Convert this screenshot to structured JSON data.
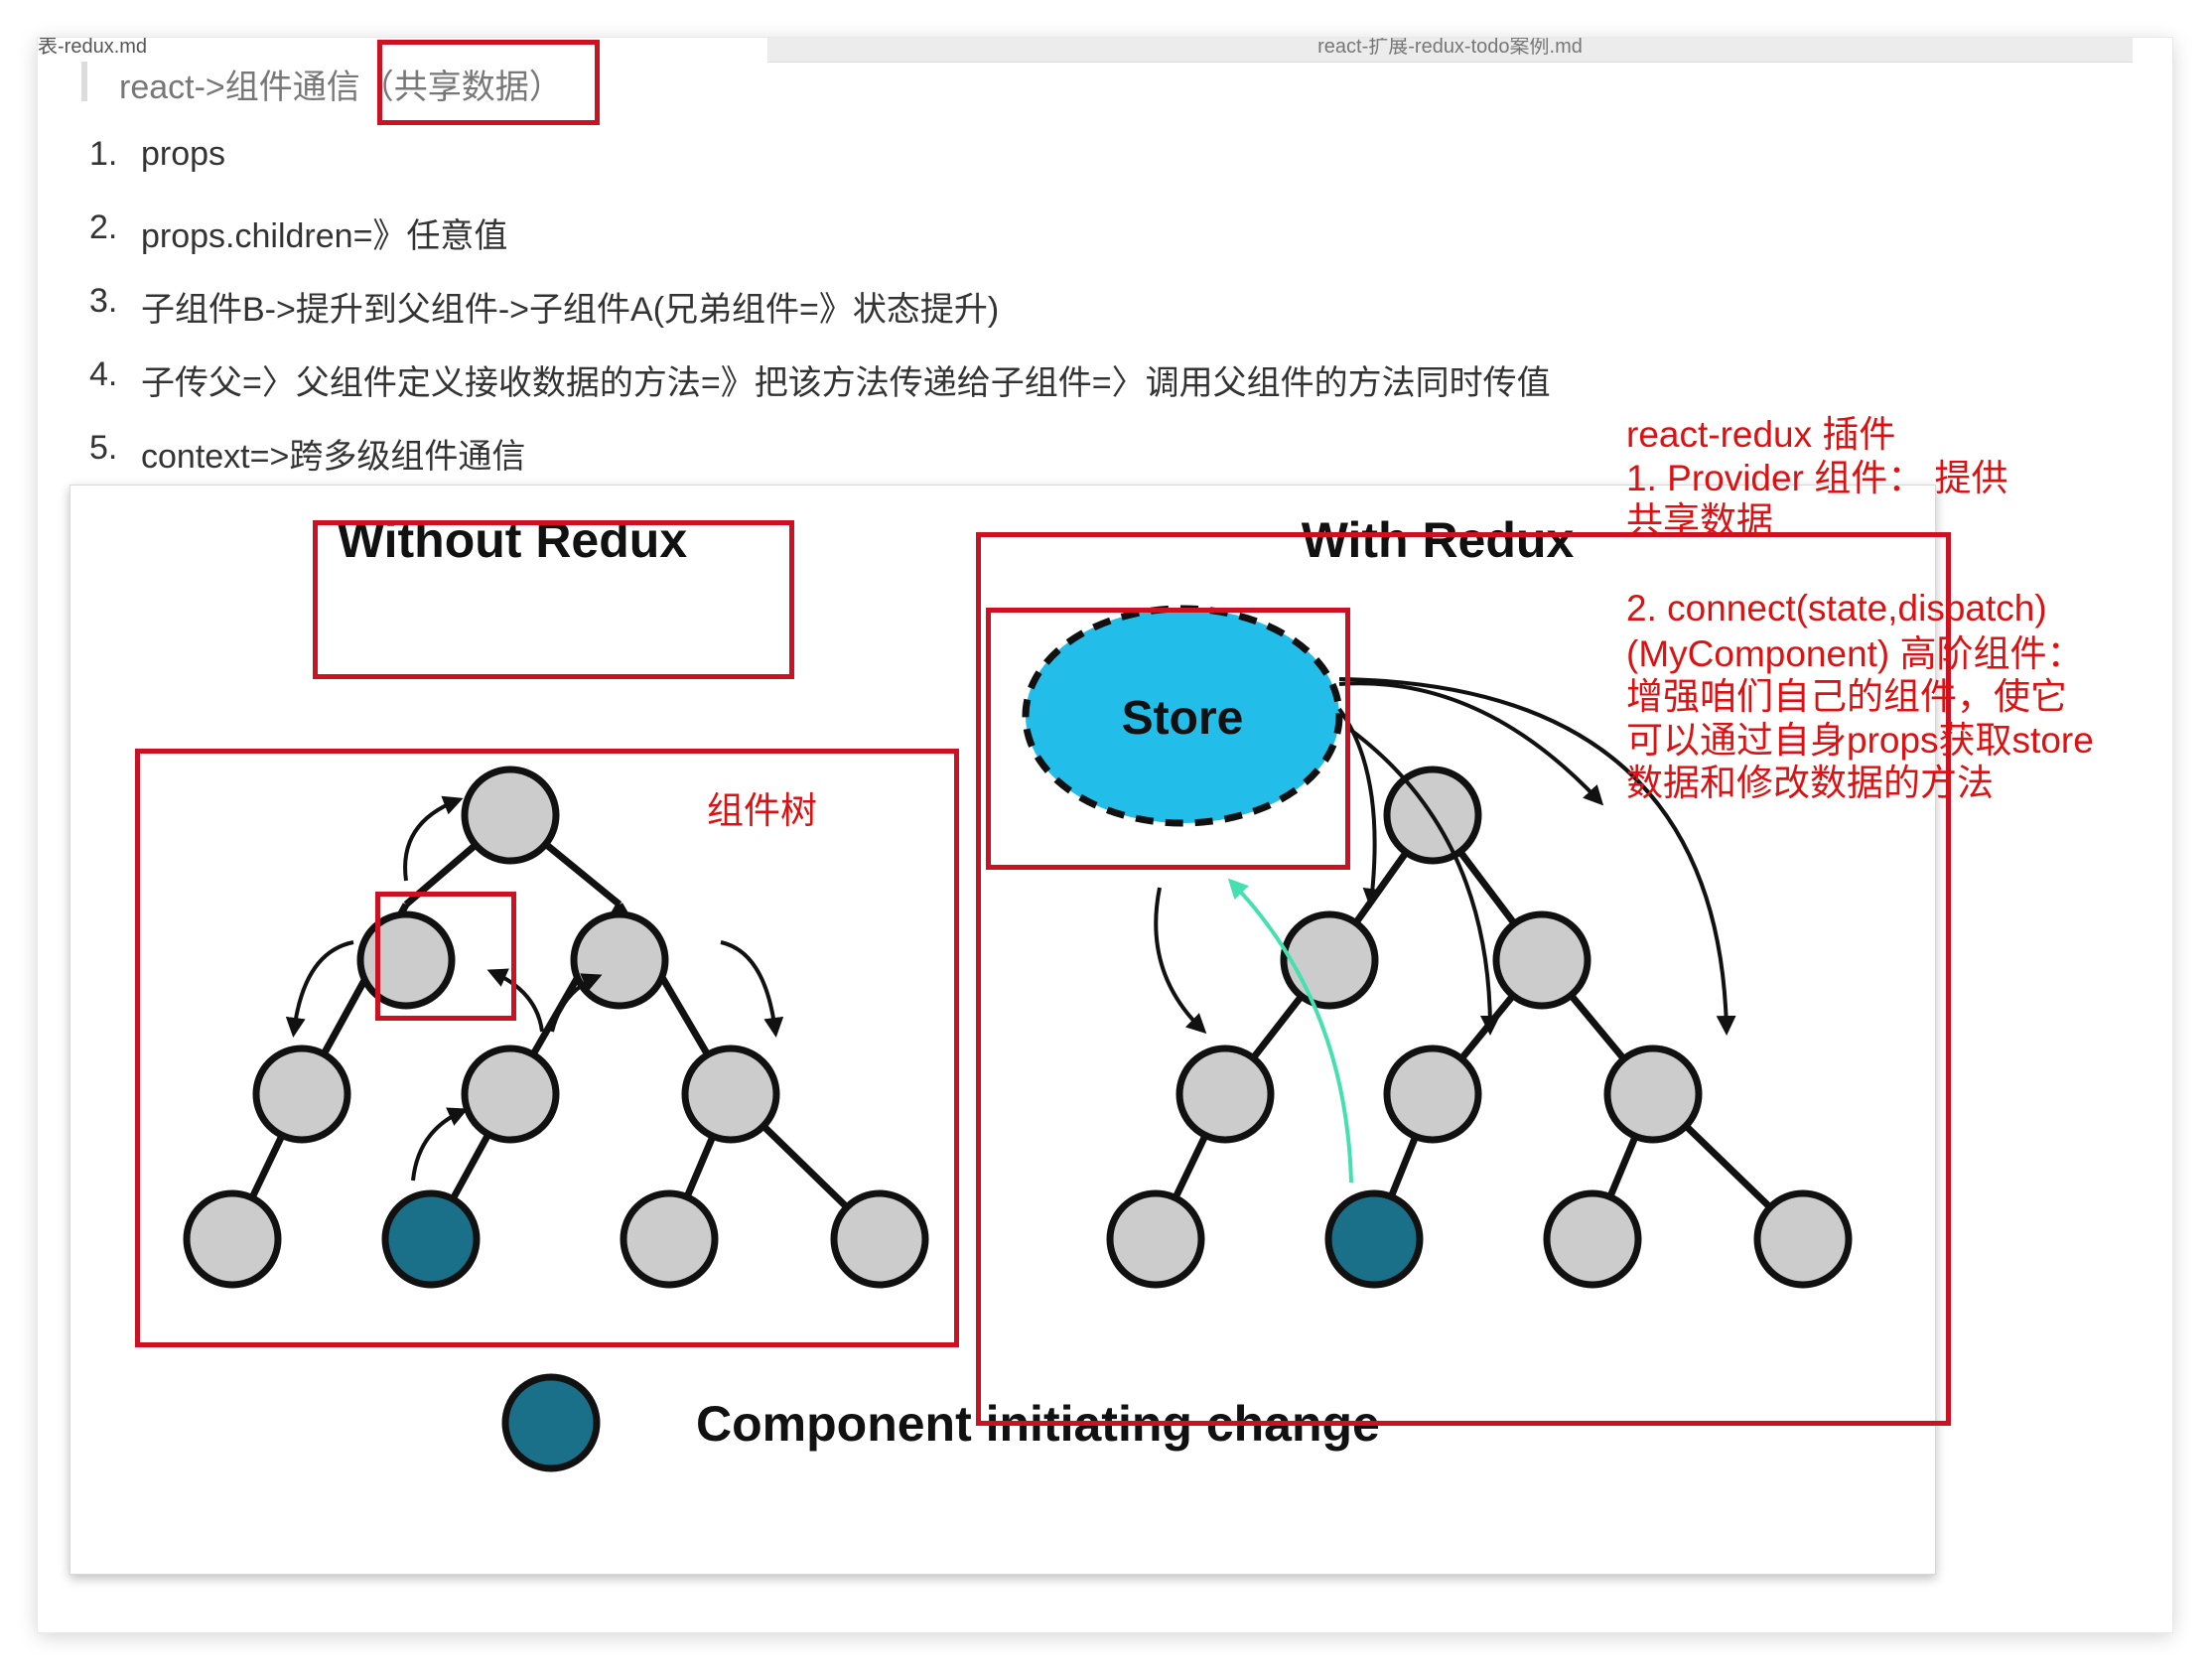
{
  "tabs": {
    "left": "表-redux.md",
    "right": "react-扩展-redux-todo案例.md"
  },
  "heading": {
    "prefix": "react->组件通信",
    "highlight": "（共享数据）"
  },
  "list": [
    {
      "num": "1.",
      "text": "props"
    },
    {
      "num": "2.",
      "text": "props.children=》任意值"
    },
    {
      "num": "3.",
      "text": "子组件B->提升到父组件->子组件A(兄弟组件=》状态提升)"
    },
    {
      "num": "4.",
      "text": "子传父=〉父组件定义接收数据的方法=》把该方法传递给子组件=〉调用父组件的方法同时传值"
    },
    {
      "num": "5.",
      "text": "context=>跨多级组件通信"
    }
  ],
  "diagram": {
    "without_title": "Without Redux",
    "with_title": "With Redux",
    "store_label": "Store",
    "legend_label": "Component initiating change"
  },
  "annotations": {
    "tree_label": "组件树",
    "redux_notes": [
      "react-redux 插件",
      "1. Provider 组件：  提供",
      "共享数据",
      "",
      "2. connect(state,dispatch)",
      "(MyComponent) 高阶组件：",
      "增强咱们自己的组件，使它",
      "可以通过自身props获取store",
      "数据和修改数据的方法"
    ]
  },
  "colors": {
    "annotation_red": "#cc1122",
    "node_gray": "#cccccc",
    "node_teal": "#1a7088",
    "store_blue": "#23bde9",
    "green_arrow": "#44e0b0"
  }
}
